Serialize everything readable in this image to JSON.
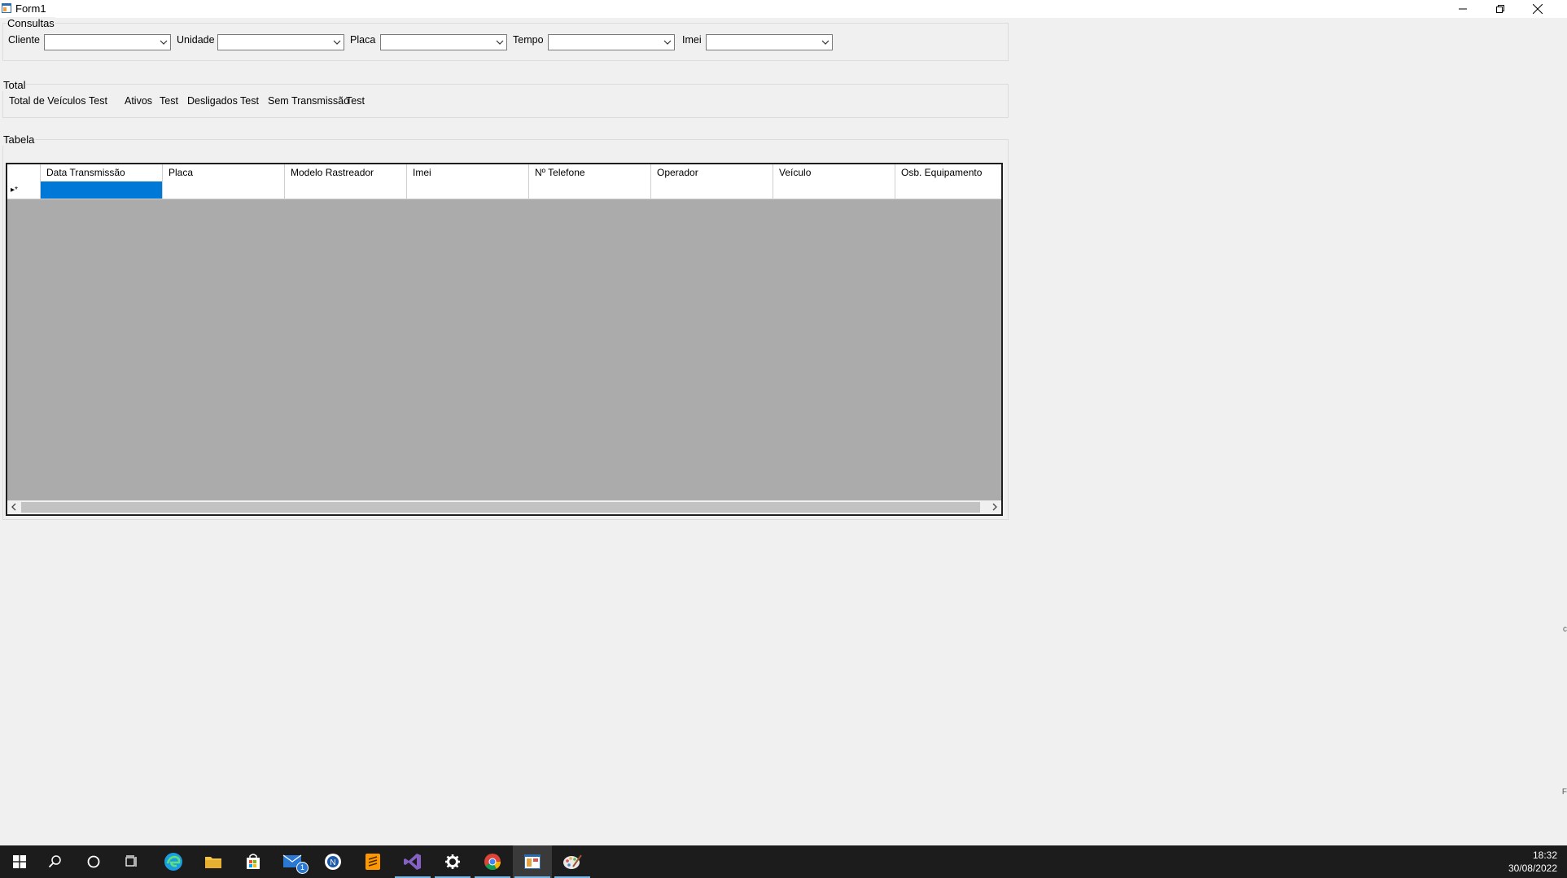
{
  "window": {
    "title": "Form1",
    "controls": [
      "minimize-icon",
      "restore-icon",
      "close-icon"
    ]
  },
  "consultas": {
    "group_label": "Consultas",
    "filters": [
      {
        "label": "Cliente",
        "value": ""
      },
      {
        "label": "Unidade",
        "value": ""
      },
      {
        "label": "Placa",
        "value": ""
      },
      {
        "label": "Tempo",
        "value": ""
      },
      {
        "label": "Imei",
        "value": ""
      }
    ]
  },
  "total": {
    "group_label": "Total",
    "items": [
      {
        "label": "Total de Veículos",
        "value": "Test"
      },
      {
        "label": "Ativos",
        "value": "Test"
      },
      {
        "label": "Desligados",
        "value": "Test"
      },
      {
        "label": "Sem Transmissão",
        "value": "Test"
      }
    ]
  },
  "tabela": {
    "group_label": "Tabela",
    "columns": [
      "Data Transmissão",
      "Placa",
      "Modelo Rastreador",
      "Imei",
      "Nº Telefone",
      "Operador",
      "Veículo",
      "Osb. Equipamento"
    ],
    "new_row_marker": "▸*",
    "rows": []
  },
  "taskbar": {
    "icons": [
      "windows-start-icon",
      "search-icon",
      "cortana-icon",
      "task-view-icon",
      "edge-icon",
      "file-explorer-icon",
      "store-icon",
      "mail-icon",
      "app-icon",
      "sublime-text-icon",
      "visual-studio-icon",
      "settings-icon",
      "chrome-icon",
      "winforms-app-icon",
      "paint-icon"
    ],
    "mail_badge": "1",
    "time": "18:32",
    "date": "30/08/2022"
  },
  "edge_chars": {
    "mid": "c",
    "bottom": "F"
  },
  "colors": {
    "selection": "#0078d7",
    "grid_background": "#ababab",
    "taskbar": "#1c1c1c",
    "active_indicator": "#76b9ed"
  }
}
